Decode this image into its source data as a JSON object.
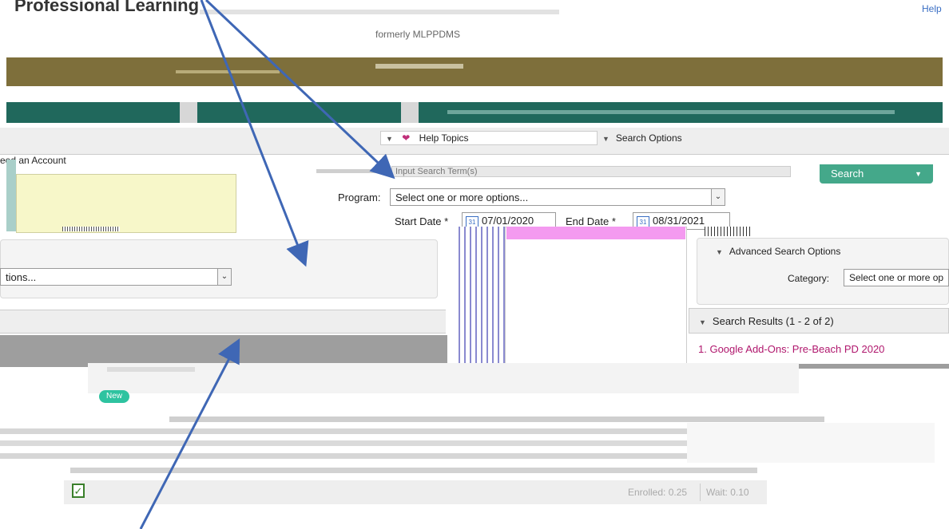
{
  "header": {
    "title": "Professional Learning",
    "subtitle": "formerly MLPPDMS",
    "help_link": "Help"
  },
  "nav": {
    "need_account": "eed an Account",
    "help_topics": "Help Topics",
    "search_options": "Search Options"
  },
  "search": {
    "placeholder": "Input Search Term(s)",
    "button": "Search",
    "program_label": "Program:",
    "program_value": "Select one or more options...",
    "start_label": "Start Date *",
    "start_value": "07/01/2020",
    "end_label": "End Date *",
    "end_value": "08/31/2021",
    "calendar_day": "31"
  },
  "left_panel": {
    "select_value": "tions..."
  },
  "advanced": {
    "header": "Advanced Search Options",
    "category_label": "Category:",
    "category_value": "Select one or more op"
  },
  "results": {
    "header": "Search Results (1 - 2 of 2)",
    "first_item": "1. Google Add-Ons: Pre-Beach PD 2020"
  },
  "listing": {
    "badge": "New",
    "enrolled": "Enrolled: 0.25",
    "wait": "Wait: 0.10"
  },
  "colors": {
    "olive": "#7e6f3b",
    "teal": "#20685c",
    "search_green": "#44a88a",
    "magenta": "#b0176d",
    "pink": "#f49af0",
    "arrow_blue": "#3f67b5"
  }
}
